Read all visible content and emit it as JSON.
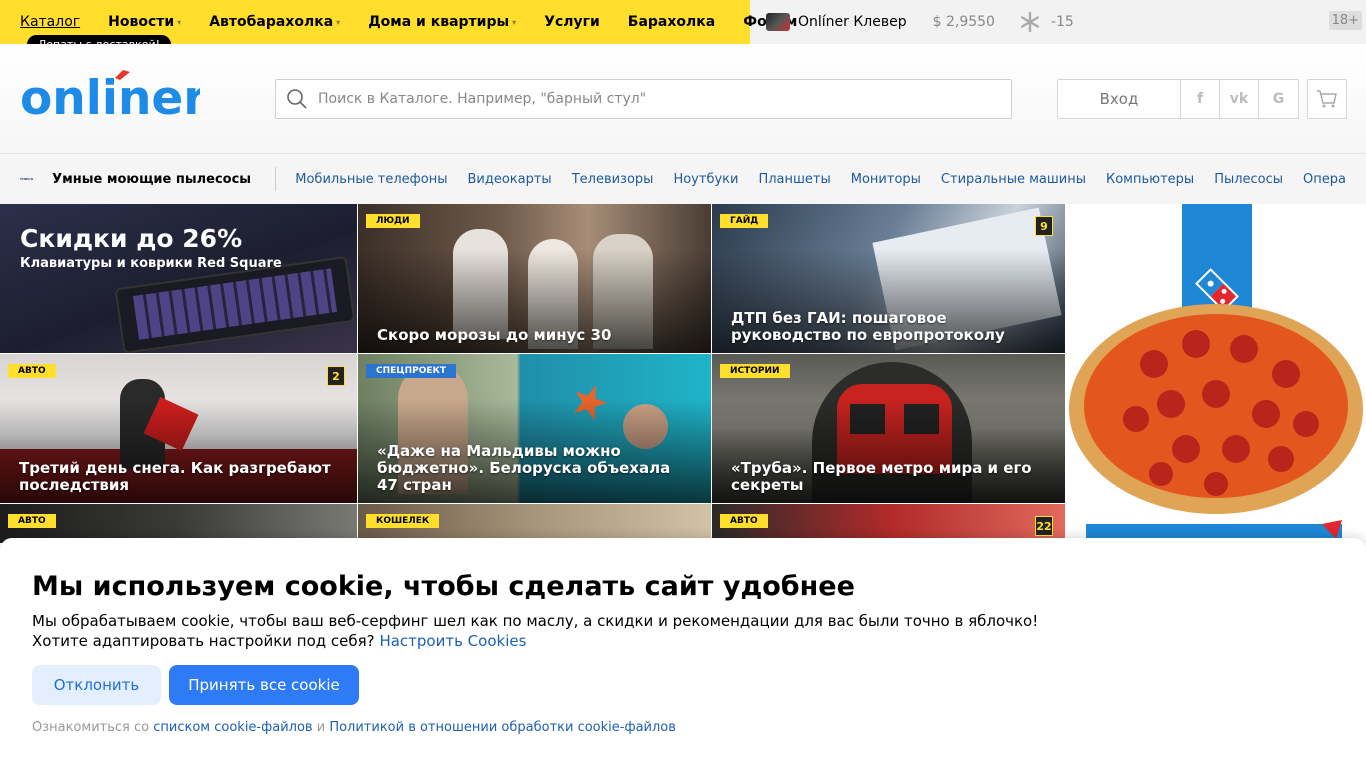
{
  "topnav": {
    "items": [
      {
        "label": "Каталог"
      },
      {
        "label": "Новости"
      },
      {
        "label": "Автобарахолка"
      },
      {
        "label": "Дома и квартиры"
      },
      {
        "label": "Услуги"
      },
      {
        "label": "Барахолка"
      },
      {
        "label": "Форум"
      }
    ],
    "tooltip": "Лопаты с доставкой!"
  },
  "tools": {
    "clever": "Onlíner Клевер",
    "rate": "$ 2,9550",
    "temperature": "-15",
    "age": "18+"
  },
  "header": {
    "logo_text": "onliner",
    "search_placeholder": "Поиск в Каталоге. Например, \"барный стул\"",
    "login": "Вход",
    "social": [
      "f",
      "vk",
      "G"
    ]
  },
  "catalog": {
    "brand": "TINECO",
    "promo": "Умные моющие пылесосы",
    "links": [
      "Мобильные телефоны",
      "Видеокарты",
      "Телевизоры",
      "Ноутбуки",
      "Планшеты",
      "Мониторы",
      "Стиральные машины",
      "Компьютеры",
      "Пылесосы",
      "Опера"
    ]
  },
  "tiles": {
    "promo": {
      "title": "Скидки до 26%",
      "subtitle": "Клавиатуры и коврики Red Square"
    },
    "t1": {
      "tag": "Люди",
      "title": "Скоро морозы до минус 30"
    },
    "t2": {
      "tag": "Гайд",
      "title": "ДТП без ГАИ: пошаговое руководство по европротоколу",
      "count": "9"
    },
    "t3": {
      "tag": "Авто",
      "title": "Третий день снега. Как разгребают последствия",
      "count": "2"
    },
    "t4": {
      "tag": "Спецпроект",
      "title": "«Даже на Мальдивы можно бюджетно». Белоруска объехала 47 стран"
    },
    "t5": {
      "tag": "Истории",
      "title": "«Труба». Первое метро мира и его секреты"
    },
    "t6": {
      "tag": "Авто"
    },
    "t7": {
      "tag": "Кошелек"
    },
    "t8": {
      "tag": "Авто",
      "count": "22"
    }
  },
  "cookie": {
    "title": "Мы используем cookie, чтобы сделать сайт удобнее",
    "text1": "Мы обрабатываем cookie, чтобы ваш веб-серфинг шел как по маслу, а скидки и рекомендации для вас были точно в яблочко!",
    "text2": "Хотите адаптировать настройки под себя?",
    "settings_link": "Настроить Cookies",
    "decline": "Отклонить",
    "accept": "Принять все cookie",
    "fine_prefix": "Ознакомиться со",
    "fine_link1": "списком cookie-файлов",
    "fine_and": "и",
    "fine_link2": "Политикой в отношении обработки cookie-файлов"
  },
  "colors": {
    "yellow": "#ffdf2b",
    "blue": "#2f7bf5",
    "link": "#1d5fb4"
  }
}
